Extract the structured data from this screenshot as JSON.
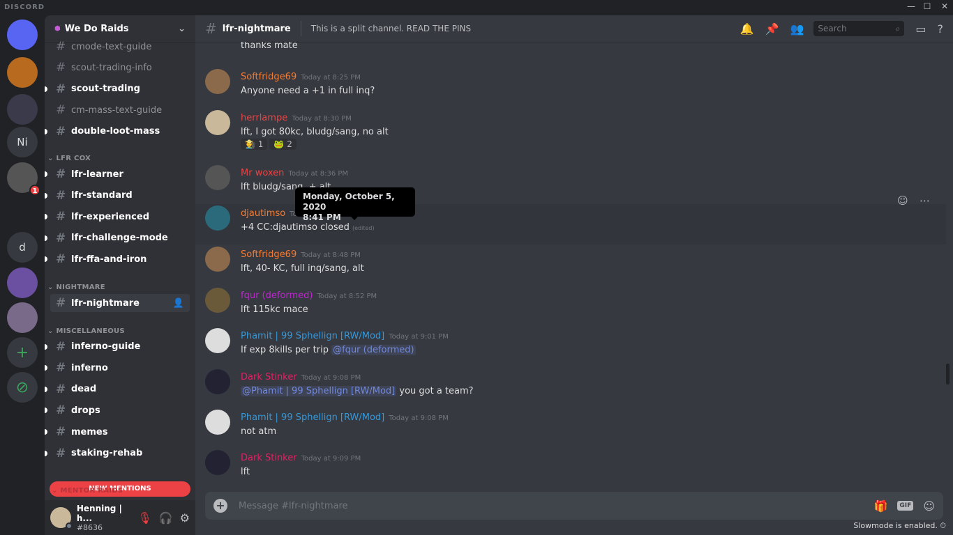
{
  "app": {
    "brand": "DISCORD"
  },
  "servers": [
    {
      "label": ""
    },
    {
      "label": ""
    },
    {
      "label": ""
    },
    {
      "label": "Ni"
    },
    {
      "label": "",
      "badge": "1"
    },
    {
      "label": ""
    },
    {
      "label": "d"
    },
    {
      "label": ""
    },
    {
      "label": ""
    },
    {
      "label": "+"
    },
    {
      "label": "⊘"
    }
  ],
  "guild": {
    "name": "We Do Raids"
  },
  "channels": [
    {
      "name": "cmode-text-guide",
      "unread": false
    },
    {
      "name": "scout-trading-info",
      "unread": false
    },
    {
      "name": "scout-trading",
      "unread": true
    },
    {
      "name": "cm-mass-text-guide",
      "unread": false
    },
    {
      "name": "double-loot-mass",
      "unread": true
    }
  ],
  "categories": [
    {
      "name": "LFR COX",
      "channels": [
        "lfr-learner",
        "lfr-standard",
        "lfr-experienced",
        "lfr-challenge-mode",
        "lfr-ffa-and-iron"
      ]
    },
    {
      "name": "NIGHTMARE",
      "channels": [
        "lfr-nightmare"
      ]
    },
    {
      "name": "MISCELLANEOUS",
      "channels": [
        "inferno-guide",
        "inferno",
        "dead",
        "drops",
        "memes",
        "staking-rehab"
      ]
    }
  ],
  "new_mentions": "NEW MENTIONS",
  "hidden_category": "MENTOR RAIDS",
  "user": {
    "name": "Henning | h...",
    "tag": "#8636"
  },
  "header": {
    "channel": "lfr-nightmare",
    "topic": "This is a split channel. READ THE PINS",
    "search_placeholder": "Search"
  },
  "messages": [
    {
      "author": "",
      "time": "",
      "text": "thanks mate",
      "color": "#f47b33"
    },
    {
      "author": "Softfridge69",
      "time": "Today at 8:25 PM",
      "text": "Anyone need a +1 in full inq?",
      "color": "#f47b33"
    },
    {
      "author": "herrlampe",
      "time": "Today at 8:30 PM",
      "text": "lft, I got 80kc, bludg/sang, no alt",
      "color": "#ed4245",
      "reactions": [
        {
          "emoji": "🧑‍🌾",
          "count": "1"
        },
        {
          "emoji": "🐸",
          "count": "2"
        }
      ]
    },
    {
      "author": "Mr woxen",
      "time": "Today at 8:36 PM",
      "text": "lft bludg/sang. + alt",
      "color": "#ed4245"
    },
    {
      "author": "djautimso",
      "time": "Today at 8:41 PM",
      "text": "+4 CC:djautimso  closed",
      "edited": "(edited)",
      "color": "#f47b33"
    },
    {
      "author": "Softfridge69",
      "time": "Today at 8:48 PM",
      "text": "lft, 40- KC, full inq/sang, alt",
      "color": "#f47b33"
    },
    {
      "author": "fqur (deformed)",
      "time": "Today at 8:52 PM",
      "text": "lft 115kc mace",
      "color": "#c026d3"
    },
    {
      "author": "Phamit | 99 Sphellign [RW/Mod]",
      "time": "Today at 9:01 PM",
      "text": "If exp 8kills per trip ",
      "mention": "@fqur (deformed)",
      "color": "#3498db"
    },
    {
      "author": "Dark Stinker",
      "time": "Today at 9:08 PM",
      "mention_first": "@Phamit | 99 Sphellign [RW/Mod]",
      "text": " you got a team?",
      "color": "#e91e63"
    },
    {
      "author": "Phamit | 99 Sphellign [RW/Mod]",
      "time": "Today at 9:08 PM",
      "text": "not atm",
      "color": "#3498db"
    },
    {
      "author": "Dark Stinker",
      "time": "Today at 9:09 PM",
      "text": "lft",
      "color": "#e91e63"
    }
  ],
  "tooltip": {
    "date": "Monday, October 5, 2020",
    "time": "8:41 PM"
  },
  "composer": {
    "placeholder": "Message #lfr-nightmare",
    "gif": "GIF"
  },
  "slowmode": "Slowmode is enabled."
}
